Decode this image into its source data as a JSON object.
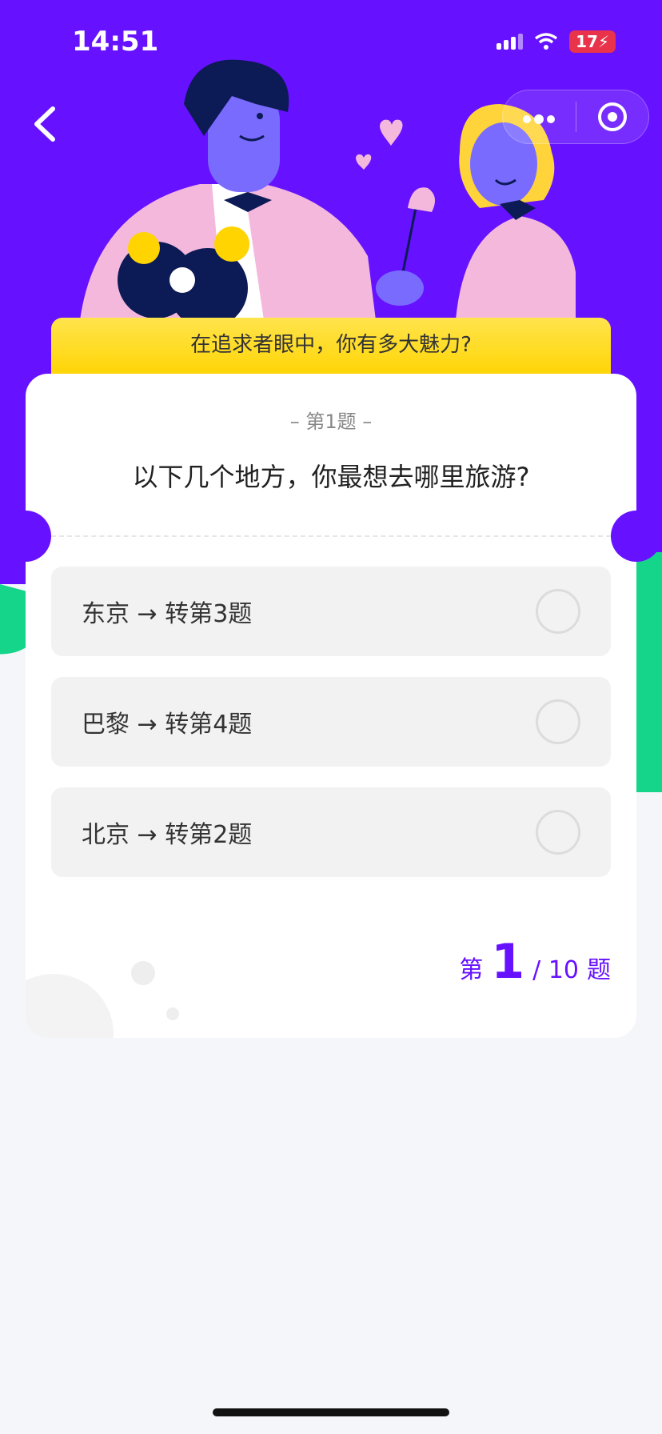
{
  "status_bar": {
    "time": "14:51",
    "battery": "17"
  },
  "nav": {
    "back_icon": "chevron-left-icon",
    "more_icon": "more-dots-icon",
    "target_icon": "target-icon"
  },
  "quiz": {
    "title": "在追求者眼中，你有多大魅力?",
    "question_index": "– 第1题 –",
    "question": "以下几个地方，你最想去哪里旅游?",
    "options": [
      {
        "label": "东京 → 转第3题",
        "selected": false
      },
      {
        "label": "巴黎 → 转第4题",
        "selected": false
      },
      {
        "label": "北京 → 转第2题",
        "selected": false
      }
    ],
    "progress": {
      "prefix": "第",
      "current": "1",
      "separator": "/ 10",
      "suffix": "题"
    }
  },
  "colors": {
    "accent": "#6611ff",
    "banner": "#ffd400",
    "green": "#15d58a"
  }
}
